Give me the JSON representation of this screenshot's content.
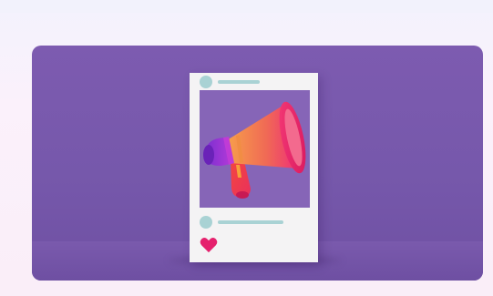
{
  "scene": {
    "description_visible_text": "",
    "icons": {
      "avatar_top": "avatar-placeholder",
      "avatar_bottom": "avatar-placeholder",
      "like": "heart-icon",
      "media": "megaphone-illustration"
    },
    "colors": {
      "page_background": "#f7f0fb",
      "hero_background": "#7a5aad",
      "card_background": "#f4f3f4",
      "placeholder_teal": "#a9d2d4",
      "heart_pink": "#e5206d",
      "megaphone_orange": "#f28b3a",
      "megaphone_pink": "#ee2d78",
      "megaphone_purple": "#8a3bd1"
    }
  }
}
